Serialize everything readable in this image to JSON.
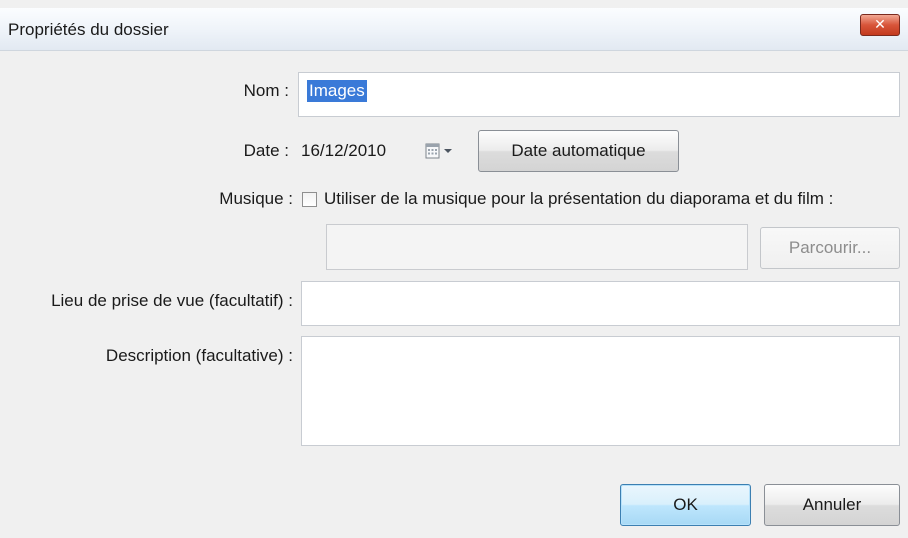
{
  "window": {
    "title": "Propriétés du dossier",
    "close_glyph": "✕"
  },
  "form": {
    "name_label": "Nom :",
    "name_value": "Images",
    "date_label": "Date :",
    "date_value": "16/12/2010",
    "date_auto_button": "Date automatique",
    "music_label": "Musique :",
    "music_checkbox_label": "Utiliser de la musique pour la présentation du diaporama et du film :",
    "music_checked": false,
    "music_path_value": "",
    "browse_button": "Parcourir...",
    "location_label": "Lieu de prise de vue (facultatif) :",
    "location_value": "",
    "description_label": "Description (facultative) :",
    "description_value": ""
  },
  "actions": {
    "ok_label": "OK",
    "cancel_label": "Annuler"
  },
  "icons": {
    "calendar": "calendar-icon",
    "close": "close-icon"
  },
  "colors": {
    "selection": "#3a7ad8",
    "close_button": "#d8553a",
    "default_button_border": "#3c7fb1"
  }
}
